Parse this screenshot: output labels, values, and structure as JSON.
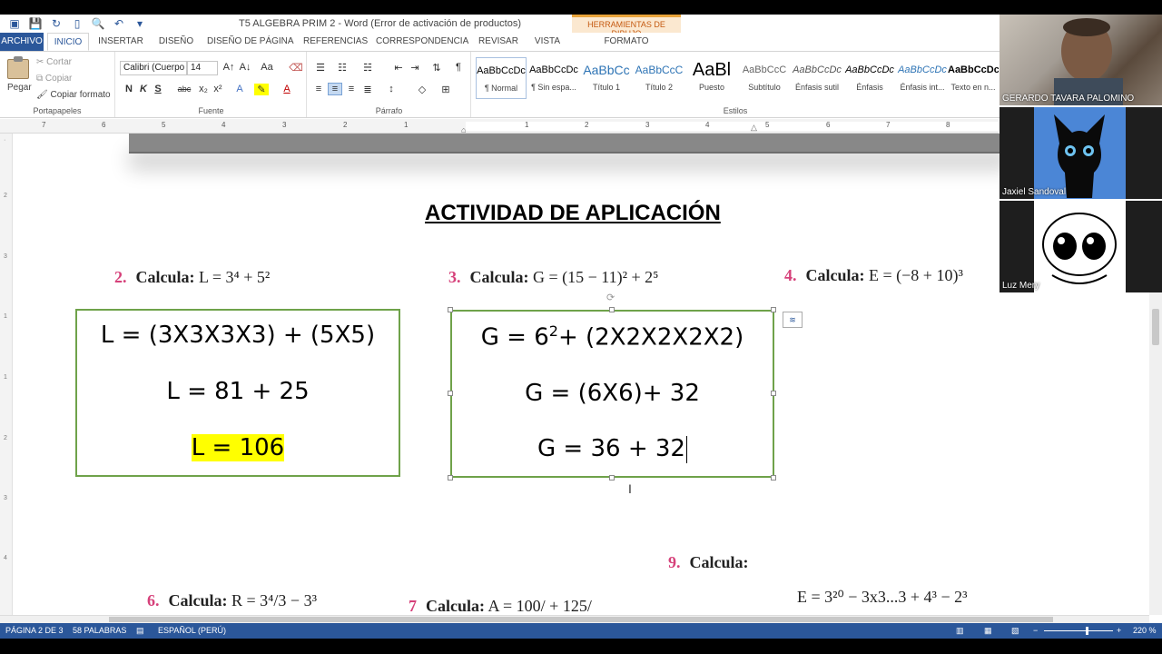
{
  "window": {
    "title": "T5 ALGEBRA PRIM 2 - Word (Error de activación de productos)",
    "contextual_header": "HERRAMIENTAS DE DIBUJO"
  },
  "quick_access": [
    "save-icon",
    "undo-icon",
    "new-doc-icon",
    "print-preview-icon",
    "undo-arrow-icon",
    "customize-icon"
  ],
  "tabs": {
    "file": "ARCHIVO",
    "items": [
      "INICIO",
      "INSERTAR",
      "DISEÑO",
      "DISEÑO DE PÁGINA",
      "REFERENCIAS",
      "CORRESPONDENCIA",
      "REVISAR",
      "VISTA"
    ],
    "format": "FORMATO"
  },
  "ribbon": {
    "clipboard": {
      "paste": "Pegar",
      "cut": "Cortar",
      "copy": "Copiar",
      "format_painter": "Copiar formato",
      "label": "Portapapeles"
    },
    "font": {
      "name": "Calibri (Cuerpo",
      "size": "14",
      "label": "Fuente",
      "bold": "N",
      "italic": "K",
      "underline": "S",
      "strike": "abc",
      "sub": "x₂",
      "sup": "x²"
    },
    "paragraph": {
      "label": "Párrafo"
    },
    "styles": {
      "label": "Estilos",
      "items": [
        {
          "preview": "AaBbCcDc",
          "name": "¶ Normal"
        },
        {
          "preview": "AaBbCcDc",
          "name": "¶ Sin espa..."
        },
        {
          "preview": "AaBbCc",
          "name": "Título 1"
        },
        {
          "preview": "AaBbCcC",
          "name": "Título 2"
        },
        {
          "preview": "AaBl",
          "name": "Puesto"
        },
        {
          "preview": "AaBbCcC",
          "name": "Subtítulo"
        },
        {
          "preview": "AaBbCcDc",
          "name": "Énfasis sutil"
        },
        {
          "preview": "AaBbCcDc",
          "name": "Énfasis"
        },
        {
          "preview": "AaBbCcDc",
          "name": "Énfasis int..."
        },
        {
          "preview": "AaBbCcDc",
          "name": "Texto en n..."
        }
      ]
    }
  },
  "ruler": {
    "numbers": [
      "7",
      "6",
      "5",
      "4",
      "3",
      "2",
      "1",
      "1",
      "2",
      "3",
      "4",
      "5",
      "6",
      "7",
      "8"
    ]
  },
  "document": {
    "heading": "ACTIVIDAD DE APLICACIÓN",
    "problems": [
      {
        "num": "2.",
        "label": "Calcula:",
        "expr_text": "L = 3⁴ + 5²"
      },
      {
        "num": "3.",
        "label": "Calcula:",
        "expr_text": "G = (15 − 11)² + 2⁵"
      },
      {
        "num": "4.",
        "label": "Calcula:",
        "expr_text": "E = (−8 + 10)³"
      },
      {
        "num": "9.",
        "label": "Calcula:",
        "expr_text": ""
      },
      {
        "num": "6.",
        "label": "Calcula:",
        "expr_text": "R = 3⁴/3 − 3³"
      },
      {
        "num": "7",
        "label": "Calcula:",
        "expr_text": "A = 100/ + 125/"
      },
      {
        "num": "",
        "label": "",
        "expr_text": "E = 3²⁰ − 3x3...3 + 4³ − 2³"
      }
    ],
    "box_left": {
      "line1": "L = (3X3X3X3) + (5X5)",
      "line2": "L = 81 + 25",
      "line3": "L = 106"
    },
    "box_right": {
      "line1_pre": "G = 6",
      "line1_sup": "2",
      "line1_post": "+ (2X2X2X2X2)",
      "line2": "G = (6X6)+ 32",
      "line3": "G = 36  + 32"
    }
  },
  "status": {
    "page": "PÁGINA 2 DE 3",
    "words": "58 PALABRAS",
    "language": "ESPAÑOL (PERÚ)",
    "zoom": "220 %"
  },
  "participants": [
    {
      "name": "GERARDO TAVARA PALOMINO"
    },
    {
      "name": "Jaxiel Sandoval"
    },
    {
      "name": "Luz Mery"
    }
  ],
  "colors": {
    "word_blue": "#2b579a",
    "box_green": "#6fa24a",
    "highlight": "#ffff00",
    "problem_num": "#d6417a"
  }
}
